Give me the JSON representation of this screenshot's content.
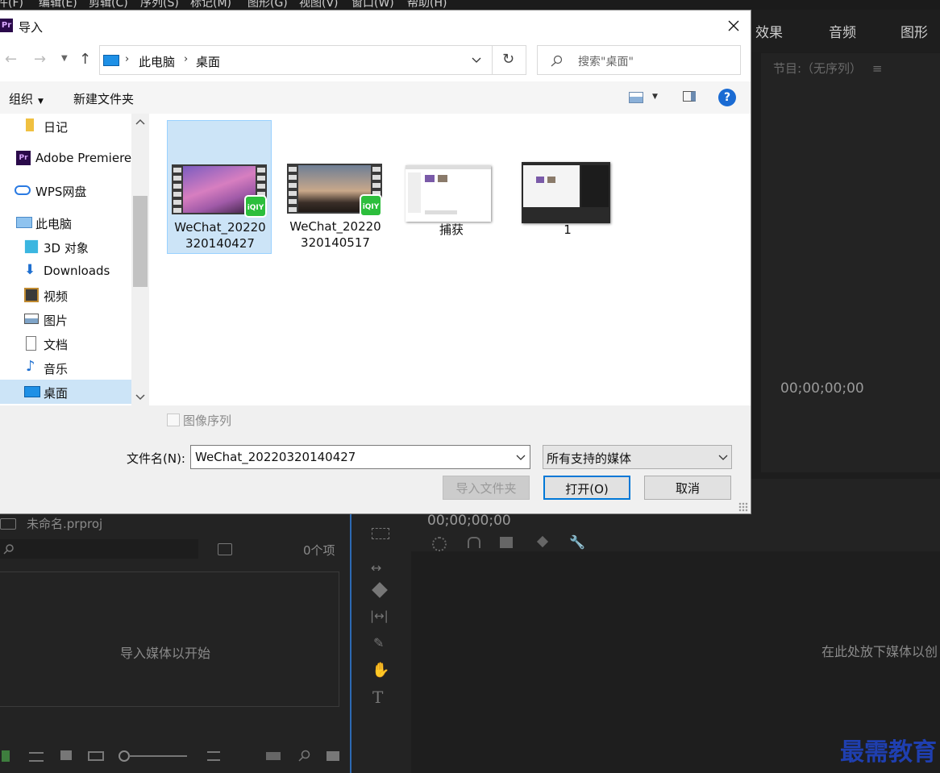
{
  "menubar": {
    "items": [
      "件(F)",
      "编辑(E)",
      "剪辑(C)",
      "序列(S)",
      "标记(M)",
      "图形(G)",
      "视图(V)",
      "窗口(W)",
      "帮助(H)"
    ]
  },
  "workspace_tabs": [
    "效果",
    "音频",
    "图形"
  ],
  "program_monitor": {
    "title": "节目:（无序列）",
    "timecode": "00;00;00;00"
  },
  "project_panel": {
    "title": "未命名.prproj",
    "item_count": "0个项",
    "empty_message": "导入媒体以开始"
  },
  "timeline": {
    "timecode": "00;00;00;00",
    "drop_message": "在此处放下媒体以创"
  },
  "watermark": "最需教育",
  "dialog": {
    "title": "导入",
    "app_icon": "Pr",
    "breadcrumb": [
      "此电脑",
      "桌面"
    ],
    "search_placeholder": "搜索\"桌面\"",
    "toolbar": {
      "organize": "组织",
      "new_folder": "新建文件夹"
    },
    "nav_items": [
      {
        "label": "日记",
        "icon": "folder-icon"
      },
      {
        "label": "Adobe Premiere",
        "icon": "premiere-icon"
      },
      {
        "label": "WPS网盘",
        "icon": "cloud-icon"
      },
      {
        "label": "此电脑",
        "icon": "computer-icon"
      },
      {
        "label": "3D 对象",
        "icon": "cube-icon"
      },
      {
        "label": "Downloads",
        "icon": "download-icon"
      },
      {
        "label": "视频",
        "icon": "video-icon"
      },
      {
        "label": "图片",
        "icon": "picture-icon"
      },
      {
        "label": "文档",
        "icon": "document-icon"
      },
      {
        "label": "音乐",
        "icon": "music-icon"
      },
      {
        "label": "桌面",
        "icon": "desktop-icon"
      }
    ],
    "files": [
      {
        "name_line1": "WeChat_20220",
        "name_line2": "320140427",
        "type": "video",
        "selected": true
      },
      {
        "name_line1": "WeChat_20220",
        "name_line2": "320140517",
        "type": "video",
        "selected": false
      },
      {
        "name_line1": "捕获",
        "name_line2": "",
        "type": "image",
        "selected": false
      },
      {
        "name_line1": "1",
        "name_line2": "",
        "type": "image",
        "selected": false
      }
    ],
    "image_sequence_label": "图像序列",
    "filename_label": "文件名(N):",
    "filename_value": "WeChat_20220320140427",
    "filter_value": "所有支持的媒体",
    "import_folder_button": "导入文件夹",
    "open_button": "打开(O)",
    "cancel_button": "取消"
  }
}
